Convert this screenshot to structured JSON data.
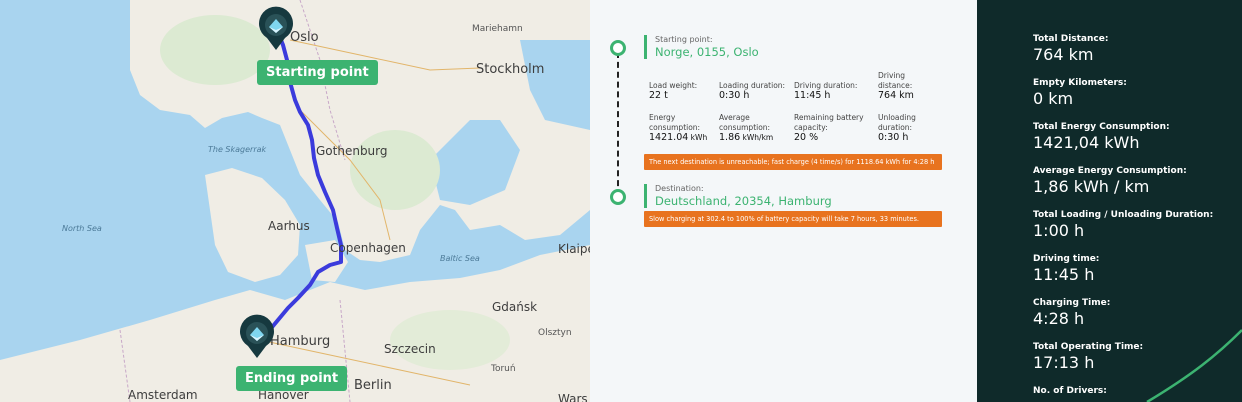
{
  "map": {
    "labels": {
      "oslo": "Oslo",
      "marieholm": "Mariehamn",
      "stockholm": "Stockholm",
      "skagerrak": "The Skagerrak",
      "gothenburg": "Gothenburg",
      "north_sea": "North Sea",
      "aarhus": "Aarhus",
      "copenhagen": "Copenhagen",
      "baltic_sea": "Baltic Sea",
      "klaipeda": "Klaipe",
      "gdansk": "Gdańsk",
      "olsztyn": "Olsztyn",
      "hamburg": "Hamburg",
      "szczecin": "Szczecin",
      "torun": "Toruń",
      "amsterdam": "Amsterdam",
      "hanover": "Hanover",
      "berlin": "Berlin",
      "warsaw": "Wars"
    },
    "start_tag": "Starting point",
    "end_tag": "Ending point",
    "route_color": "#3b3bdc",
    "pin_color": "#16393f"
  },
  "route": {
    "start_caption": "Starting point:",
    "start_value": "Norge, 0155, Oslo",
    "stats": [
      {
        "caption": "Load weight:",
        "value": "22 t",
        "unit": ""
      },
      {
        "caption": "Loading duration:",
        "value": "0:30 h",
        "unit": ""
      },
      {
        "caption": "Driving duration:",
        "value": "11:45 h",
        "unit": ""
      },
      {
        "caption": "Driving distance:",
        "value": "764 km",
        "unit": ""
      },
      {
        "caption": "Energy consumption:",
        "value": "1421.04",
        "unit": " kWh"
      },
      {
        "caption": "Average consumption:",
        "value": "1.86",
        "unit": " kWh/km"
      },
      {
        "caption": "Remaining battery capacity:",
        "value": "20 %",
        "unit": ""
      },
      {
        "caption": "Unloading duration:",
        "value": "0:30 h",
        "unit": ""
      }
    ],
    "alert1": "The next destination is unreachable; fast charge (4 time/s) for 1118.64 kWh for 4:28 h",
    "dest_caption": "Destination:",
    "dest_value": "Deutschland, 20354, Hamburg",
    "alert2": "Slow charging at 302.4 to 100% of battery capacity will take 7 hours, 33 minutes.",
    "accent": "#3cb371",
    "alert_color": "#e8731f"
  },
  "summary": {
    "items": [
      {
        "label": "Total Distance:",
        "value": "764 km"
      },
      {
        "label": "Empty Kilometers:",
        "value": "0 km"
      },
      {
        "label": "Total Energy Consumption:",
        "value": "1421,04 kWh"
      },
      {
        "label": "Average Energy Consumption:",
        "value": "1,86 kWh / km"
      },
      {
        "label": "Total Loading / Unloading Duration:",
        "value": "1:00 h"
      },
      {
        "label": "Driving time:",
        "value": "11:45 h"
      },
      {
        "label": "Charging Time:",
        "value": "4:28 h"
      },
      {
        "label": "Total Operating Time:",
        "value": "17:13 h"
      },
      {
        "label": "No. of Drivers:",
        "value": ""
      }
    ],
    "background": "#0f2a2a"
  }
}
